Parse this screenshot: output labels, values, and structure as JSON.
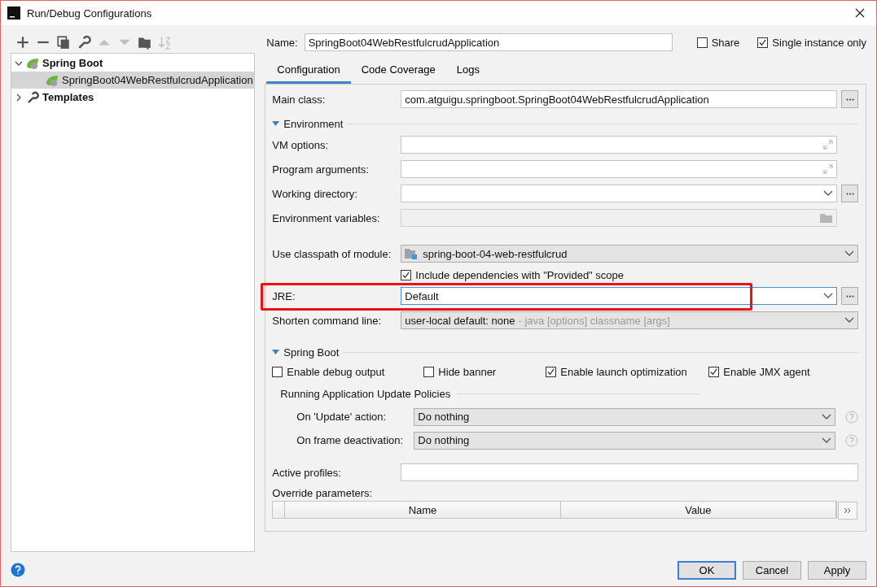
{
  "window": {
    "title": "Run/Debug Configurations"
  },
  "toolbar": [
    {
      "kind": "add",
      "disabled": false
    },
    {
      "kind": "remove",
      "disabled": false
    },
    {
      "kind": "copy",
      "disabled": false
    },
    {
      "kind": "wrench",
      "disabled": false
    },
    {
      "kind": "up",
      "disabled": true
    },
    {
      "kind": "down",
      "disabled": true
    },
    {
      "kind": "folder",
      "disabled": false
    },
    {
      "kind": "sort",
      "disabled": true
    }
  ],
  "tree": [
    {
      "label": "Spring Boot",
      "kind": "spring",
      "expanded": true,
      "selected": false,
      "children": [
        {
          "label": "SpringBoot04WebRestfulcrudApplication",
          "kind": "spring",
          "selected": true
        }
      ]
    },
    {
      "label": "Templates",
      "kind": "wrench",
      "expanded": false,
      "selected": false
    }
  ],
  "name_field": {
    "label": "Name:",
    "value": "SpringBoot04WebRestfulcrudApplication"
  },
  "options": [
    {
      "label": "Share",
      "checked": false
    },
    {
      "label": "Single instance only",
      "checked": true
    }
  ],
  "tabs": [
    {
      "label": "Configuration",
      "selected": true
    },
    {
      "label": "Code Coverage",
      "selected": false
    },
    {
      "label": "Logs",
      "selected": false
    }
  ],
  "main_class": {
    "label": "Main class:",
    "value": "com.atguigu.springboot.SpringBoot04WebRestfulcrudApplication"
  },
  "environment": {
    "title": "Environment",
    "expanded": true,
    "rows": [
      {
        "kind": "expand",
        "label": "VM options:"
      },
      {
        "kind": "expand",
        "label": "Program arguments:"
      },
      {
        "kind": "combo_browse",
        "label": "Working directory:"
      },
      {
        "kind": "folder",
        "label": "Environment variables:"
      },
      {
        "kind": "module",
        "label": "Use classpath of module:",
        "value": "spring-boot-04-web-restfulcrud"
      },
      {
        "kind": "checkbox",
        "label": "Include dependencies with \"Provided\" scope",
        "checked": true
      },
      {
        "kind": "jre",
        "label": "JRE:",
        "value": "Default",
        "highlighted": true
      },
      {
        "kind": "hint_combo",
        "label": "Shorten command line:",
        "value": "user-local default: none",
        "hint": "- java [options] classname [args]"
      }
    ]
  },
  "spring_boot": {
    "title": "Spring Boot",
    "expanded": true,
    "checkboxes": [
      {
        "label": "Enable debug output",
        "checked": false
      },
      {
        "label": "Hide banner",
        "checked": false
      },
      {
        "label": "Enable launch optimization",
        "checked": true
      },
      {
        "label": "Enable JMX agent",
        "checked": true
      }
    ],
    "policies": {
      "title": "Running Application Update Policies",
      "rows": [
        {
          "label": "On 'Update' action:",
          "value": "Do nothing"
        },
        {
          "label": "On frame deactivation:",
          "value": "Do nothing"
        }
      ]
    }
  },
  "active_profiles": {
    "label": "Active profiles:"
  },
  "override": {
    "label": "Override parameters:",
    "columns": [
      "Name",
      "Value"
    ]
  },
  "buttons": [
    {
      "label": "OK",
      "default": true
    },
    {
      "label": "Cancel",
      "default": false
    },
    {
      "label": "Apply",
      "default": false
    }
  ]
}
